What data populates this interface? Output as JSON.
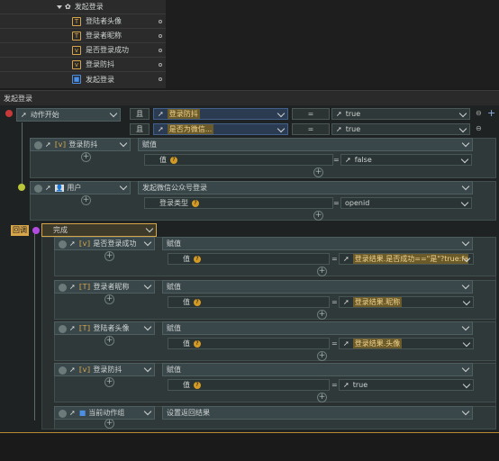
{
  "tree": {
    "root_label": "发起登录",
    "items": [
      {
        "icon": "T",
        "label": "登陆者头像"
      },
      {
        "icon": "T",
        "label": "登录者昵称"
      },
      {
        "icon": "var",
        "label": "是否登录成功"
      },
      {
        "icon": "var",
        "label": "登录防抖"
      },
      {
        "icon": "flag",
        "label": "发起登录"
      }
    ]
  },
  "panel_title": "发起登录",
  "top_row": {
    "action_label": "动作开始",
    "and_label": "且",
    "conditions": [
      {
        "field": "登录防抖",
        "op": "=",
        "value": "true"
      },
      {
        "field": "是否为微信...",
        "op": "=",
        "value": "true"
      }
    ]
  },
  "assign1": {
    "title": "登录防抖",
    "mode": "赋值",
    "value_label": "值",
    "eq": "=",
    "value": "false"
  },
  "user_block": {
    "title": "用户",
    "action": "发起微信公众号登录",
    "param_label": "登录类型",
    "eq": "=",
    "value": "openid"
  },
  "callback_label": "回调",
  "done_label": "完成",
  "assign_list": [
    {
      "title": "是否登录成功",
      "mode": "赋值",
      "value_label": "值",
      "eq": "=",
      "value": "登录结果.是否成功==\"是\"?true:false"
    },
    {
      "title": "登录者昵称",
      "mode": "赋值",
      "value_label": "值",
      "eq": "=",
      "value": "登录结果.昵称"
    },
    {
      "title": "登陆者头像",
      "mode": "赋值",
      "value_label": "值",
      "eq": "=",
      "value": "登录结果.头像"
    },
    {
      "title": "登录防抖",
      "mode": "赋值",
      "value_label": "值",
      "eq": "=",
      "value": "true"
    }
  ],
  "final_block": {
    "title": "当前动作组",
    "action": "设置返回结果"
  },
  "colors": {
    "accent": "#d8a64a",
    "panel": "#2f3939",
    "highlight": "#f1d38b"
  }
}
